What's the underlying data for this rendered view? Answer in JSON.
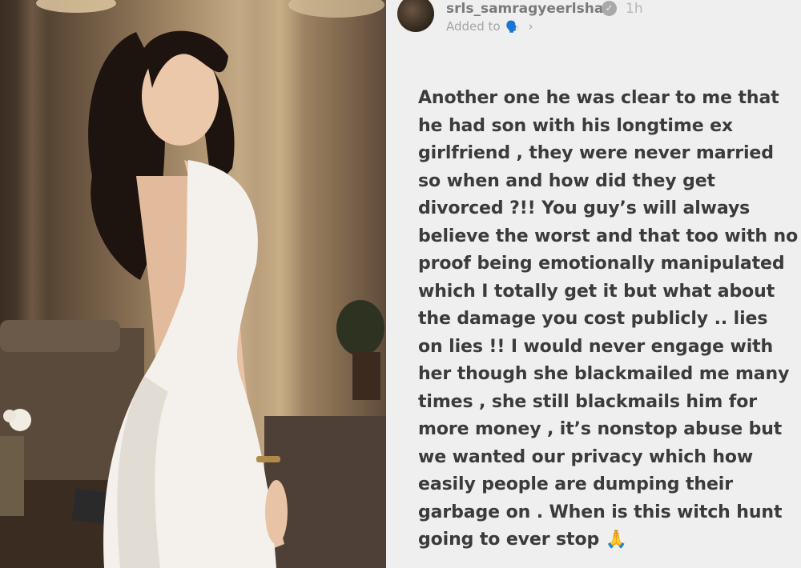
{
  "story": {
    "username": "srls_samragyeerlshah",
    "verified_icon": "verified-badge-icon",
    "time": "1h",
    "added_label": "Added to",
    "added_emoji": "🗣️",
    "chevron": "›",
    "text_lines": [
      "Another one he was clear to me that",
      "he had son with his longtime ex",
      "girlfriend , they were never married",
      "so when and how did they get",
      "divorced ?!! You guy’s will always",
      "believe the worst and that too with no",
      "proof being emotionally manipulated",
      "which I totally get it but what about",
      "the damage you cost publicly .. lies",
      "on lies !! I would never engage with",
      "her though she blackmailed me many",
      "times , she still blackmails him for",
      "more money , it’s nonstop abuse but",
      "we wanted our privacy which how",
      "easily people are dumping their",
      "garbage on . When is this witch hunt",
      "going to ever stop 🙏"
    ]
  },
  "colors": {
    "story_background": "#efefef",
    "text": "#3b3b3b",
    "header_text": "#7a7a7a",
    "dress": "#f4f1ec"
  }
}
